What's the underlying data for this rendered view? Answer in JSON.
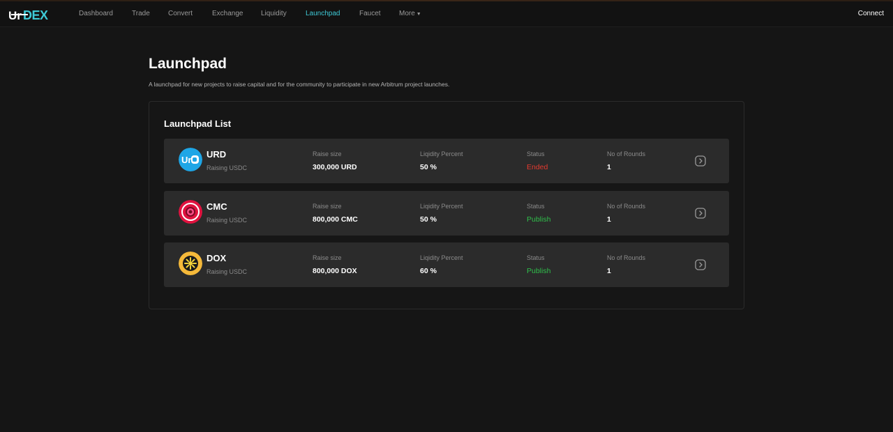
{
  "header": {
    "logo_text": "UrDEX",
    "nav": [
      "Dashboard",
      "Trade",
      "Convert",
      "Exchange",
      "Liquidity",
      "Launchpad",
      "Faucet",
      "More"
    ],
    "active_nav": "Launchpad",
    "connect_label": "Connect"
  },
  "page": {
    "title": "Launchpad",
    "description": "A launchpad for new projects to raise capital and for the community to participate in new Arbitrum project launches."
  },
  "list": {
    "title": "Launchpad List",
    "labels": {
      "raise_size": "Raise size",
      "liquidity": "Liqidity Percent",
      "status": "Status",
      "rounds": "No of Rounds"
    },
    "rows": [
      {
        "symbol": "URD",
        "raising": "Raising USDC",
        "raise_size": "300,000 URD",
        "liquidity": "50 %",
        "status": "Ended",
        "rounds": "1",
        "icon": "urd-token-icon"
      },
      {
        "symbol": "CMC",
        "raising": "Raising USDC",
        "raise_size": "800,000 CMC",
        "liquidity": "50 %",
        "status": "Publish",
        "rounds": "1",
        "icon": "cmc-token-icon"
      },
      {
        "symbol": "DOX",
        "raising": "Raising USDC",
        "raise_size": "800,000 DOX",
        "liquidity": "60 %",
        "status": "Publish",
        "rounds": "1",
        "icon": "dox-token-icon"
      }
    ]
  },
  "colors": {
    "accent": "#3ec9d6",
    "ended": "#e53a2f",
    "publish": "#2fbf4b",
    "row_bg": "#2b2b2b",
    "page_bg": "#151515"
  }
}
